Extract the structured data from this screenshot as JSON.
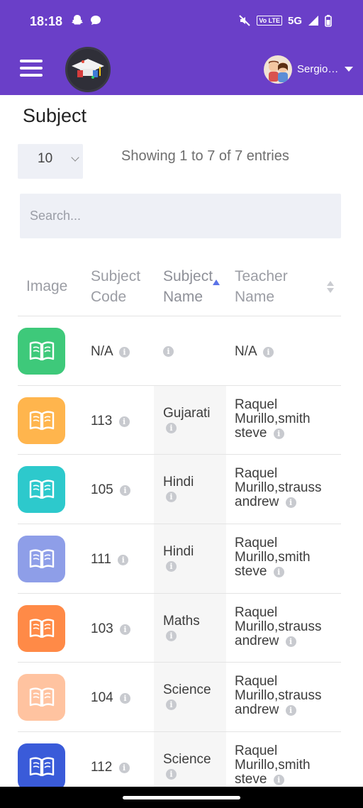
{
  "status_bar": {
    "time": "18:18",
    "network": "5G",
    "volte": "Vo LTE"
  },
  "header": {
    "user_name": "Sergio…"
  },
  "page": {
    "title": "Subject",
    "page_size": "10",
    "entries_info": "Showing 1 to 7 of 7 entries",
    "search_placeholder": "Search..."
  },
  "table": {
    "columns": {
      "image": "Image",
      "code_line1": "Subject",
      "code_line2": "Code",
      "name_line1": "Subject",
      "name_line2": "Name",
      "teacher_line1": "Teacher",
      "teacher_line2": "Name"
    },
    "rows": [
      {
        "code": "N/A",
        "name": "",
        "teacher_l1": "N/A",
        "teacher_l2": "",
        "teacher_l3": "",
        "color": "#3ec97a"
      },
      {
        "code": "113",
        "name": "Gujarati",
        "teacher_l1": "Raquel",
        "teacher_l2": "Murillo,smith",
        "teacher_l3": "steve",
        "color": "#ffb54d"
      },
      {
        "code": "105",
        "name": "Hindi",
        "teacher_l1": "Raquel",
        "teacher_l2": "Murillo,strauss",
        "teacher_l3": "andrew",
        "color": "#2dc9cc"
      },
      {
        "code": "111",
        "name": "Hindi",
        "teacher_l1": "Raquel",
        "teacher_l2": "Murillo,smith",
        "teacher_l3": "steve",
        "color": "#8e9ee8"
      },
      {
        "code": "103",
        "name": "Maths",
        "teacher_l1": "Raquel",
        "teacher_l2": "Murillo,strauss",
        "teacher_l3": "andrew",
        "color": "#ff8a47"
      },
      {
        "code": "104",
        "name": "Science",
        "teacher_l1": "Raquel",
        "teacher_l2": "Murillo,strauss",
        "teacher_l3": "andrew",
        "color": "#ffc3a0"
      },
      {
        "code": "112",
        "name": "Science",
        "teacher_l1": "Raquel",
        "teacher_l2": "Murillo,smith",
        "teacher_l3": "steve",
        "color": "#3a5bd9"
      }
    ]
  },
  "colors": {
    "brand": "#6a3fc8",
    "sort_active": "#5b73e8",
    "info_icon": "#c8cacf"
  },
  "icons": [
    "menu-icon",
    "book-icon",
    "info-icon",
    "sort-icon",
    "chevron-down-icon",
    "caret-down-icon"
  ]
}
